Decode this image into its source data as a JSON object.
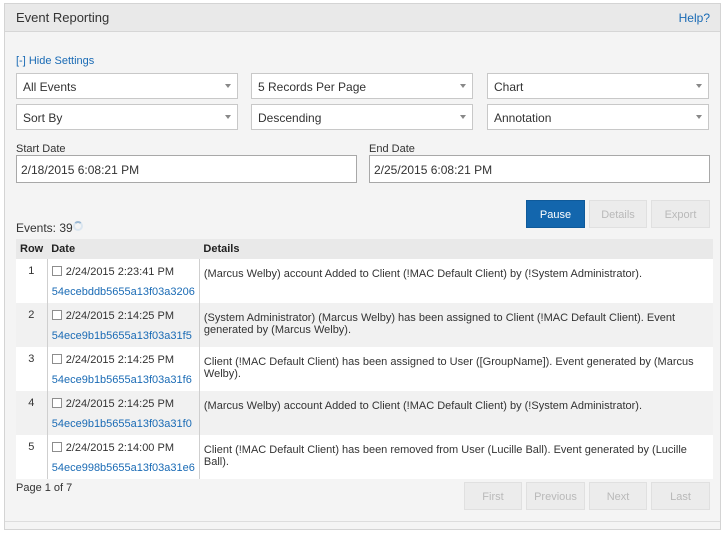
{
  "header": {
    "title": "Event Reporting",
    "help_label": "Help?"
  },
  "settings": {
    "toggle_label": "[-] Hide Settings",
    "event_filter": "All Events",
    "records_per_page": "5 Records Per Page",
    "view_mode": "Chart",
    "sort_by": "Sort By",
    "sort_order": "Descending",
    "annotation": "Annotation",
    "start_date_label": "Start Date",
    "start_date_value": "2/18/2015 6:08:21 PM",
    "end_date_label": "End Date",
    "end_date_value": "2/25/2015 6:08:21 PM"
  },
  "actions": {
    "pause": "Pause",
    "details": "Details",
    "export": "Export"
  },
  "events": {
    "count_label": "Events: 39",
    "columns": {
      "row": "Row",
      "date": "Date",
      "details": "Details"
    },
    "rows": [
      {
        "row": "1",
        "date": "2/24/2015 2:23:41 PM",
        "id": "54ecebddb5655a13f03a3206",
        "details": "(Marcus Welby) account Added to Client (!MAC Default Client) by (!System Administrator)."
      },
      {
        "row": "2",
        "date": "2/24/2015 2:14:25 PM",
        "id": "54ece9b1b5655a13f03a31f5",
        "details": "(System Administrator) (Marcus Welby) has been assigned to Client (!MAC Default Client). Event generated by (Marcus Welby)."
      },
      {
        "row": "3",
        "date": "2/24/2015 2:14:25 PM",
        "id": "54ece9b1b5655a13f03a31f6",
        "details": "Client (!MAC Default Client) has been assigned to User ([GroupName]). Event generated by (Marcus Welby)."
      },
      {
        "row": "4",
        "date": "2/24/2015 2:14:25 PM",
        "id": "54ece9b1b5655a13f03a31f0",
        "details": "(Marcus Welby) account Added to Client (!MAC Default Client) by (!System Administrator)."
      },
      {
        "row": "5",
        "date": "2/24/2015 2:14:00 PM",
        "id": "54ece998b5655a13f03a31e6",
        "details": "Client (!MAC Default Client) has been removed from User (Lucille Ball). Event generated by (Lucille Ball)."
      }
    ]
  },
  "pagination": {
    "info": "Page 1 of 7",
    "first": "First",
    "previous": "Previous",
    "next": "Next",
    "last": "Last"
  },
  "colors": {
    "primary_button": "#1366ad",
    "link": "#1a6bb5",
    "panel_bg": "#f4f4f4",
    "header_bg": "#e9e9e9"
  }
}
